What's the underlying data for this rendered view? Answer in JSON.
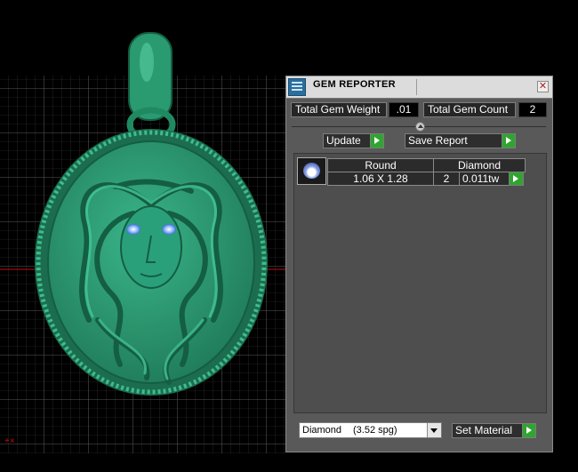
{
  "panel": {
    "title": "GEM REPORTER",
    "close_icon": "close-icon",
    "title_icon": "report-icon"
  },
  "stats": {
    "total_weight_label": "Total Gem Weight",
    "total_weight_value": ".01",
    "total_count_label": "Total Gem Count",
    "total_count_value": "2"
  },
  "buttons": {
    "update_label": "Update",
    "save_report_label": "Save Report",
    "set_material_label": "Set Material"
  },
  "gem_rows": [
    {
      "shape": "Round",
      "material": "Diamond",
      "size": "1.06 X 1.28",
      "count": "2",
      "weight": "0.011tw"
    }
  ],
  "material_select": {
    "selected_name": "Diamond",
    "selected_spg": "(3.52 spg)"
  },
  "viewport": {
    "object": "medusa pendant",
    "color_model": "#2c9a72",
    "color_grid": "#6e6e6e",
    "color_axis": "#c01010"
  }
}
